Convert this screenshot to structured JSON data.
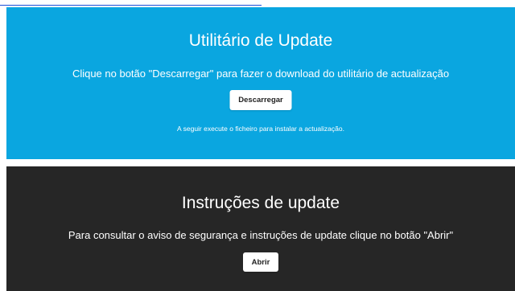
{
  "colors": {
    "update_panel_bg": "#0aa6e0",
    "instructions_panel_bg": "#262626",
    "button_bg": "#ffffff",
    "link": "#1a4fd8"
  },
  "update_panel": {
    "title": "Utilitário de Update",
    "description": "Clique no botão \"Descarregar\" para fazer o download do utilitário de actualização",
    "download_button_label": "Descarregar",
    "note": "A seguir execute o ficheiro para instalar a actualização."
  },
  "instructions_panel": {
    "title": "Instruções de update",
    "description": "Para consultar o aviso de segurança e instruções de update clique no botão \"Abrir\"",
    "open_button_label": "Abrir"
  }
}
